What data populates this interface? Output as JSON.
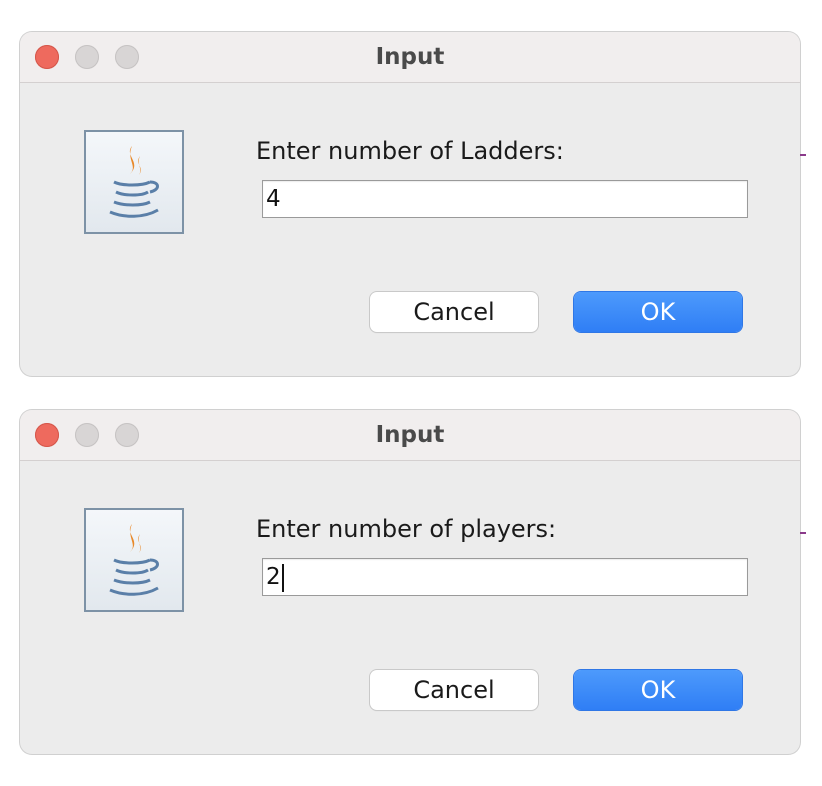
{
  "dialogs": [
    {
      "title": "Input",
      "prompt": "Enter number of Ladders:",
      "value": "4",
      "cancel_label": "Cancel",
      "ok_label": "OK",
      "focused": false
    },
    {
      "title": "Input",
      "prompt": "Enter number of players:",
      "value": "2",
      "cancel_label": "Cancel",
      "ok_label": "OK",
      "focused": true
    }
  ],
  "colors": {
    "ok_button": "#2f7ef5",
    "close_button": "#ee6a5e",
    "titlebar": "#f1eeee",
    "dialog_body": "#ececec"
  },
  "icons": {
    "app": "java-coffee-cup-icon",
    "close": "close-traffic-light-icon",
    "minimize": "minimize-traffic-light-icon",
    "zoom": "zoom-traffic-light-icon"
  }
}
